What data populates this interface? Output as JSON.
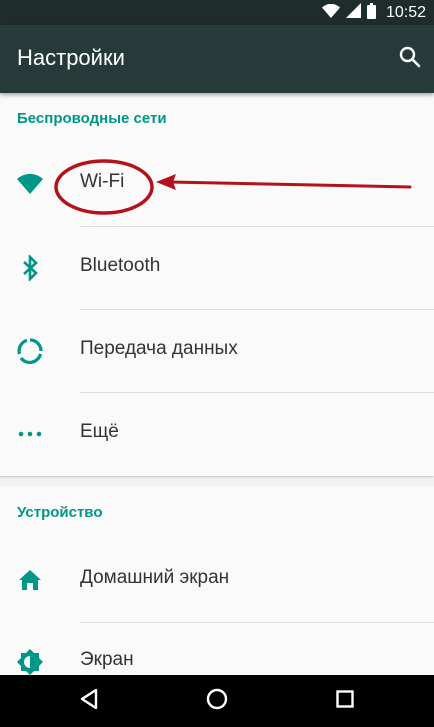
{
  "status_bar": {
    "time": "10:52",
    "icons": [
      "wifi-signal-icon",
      "cell-signal-icon",
      "battery-icon"
    ]
  },
  "app_bar": {
    "title": "Настройки",
    "search_icon": "search-icon"
  },
  "sections": [
    {
      "header": "Беспроводные сети",
      "items": [
        {
          "label": "Wi-Fi",
          "icon": "wifi-icon"
        },
        {
          "label": "Bluetooth",
          "icon": "bluetooth-icon"
        },
        {
          "label": "Передача данных",
          "icon": "data-usage-icon"
        },
        {
          "label": "Ещё",
          "icon": "more-icon"
        }
      ]
    },
    {
      "header": "Устройство",
      "items": [
        {
          "label": "Домашний экран",
          "icon": "home-icon"
        },
        {
          "label": "Экран",
          "icon": "brightness-icon"
        }
      ]
    }
  ],
  "nav_bar": {
    "buttons": [
      "back-icon",
      "home-circle-icon",
      "recents-icon"
    ]
  },
  "colors": {
    "accent": "#009688",
    "app_bar": "#263a3a",
    "status_bar": "#1e2c2b",
    "annotation": "#b3121b"
  }
}
